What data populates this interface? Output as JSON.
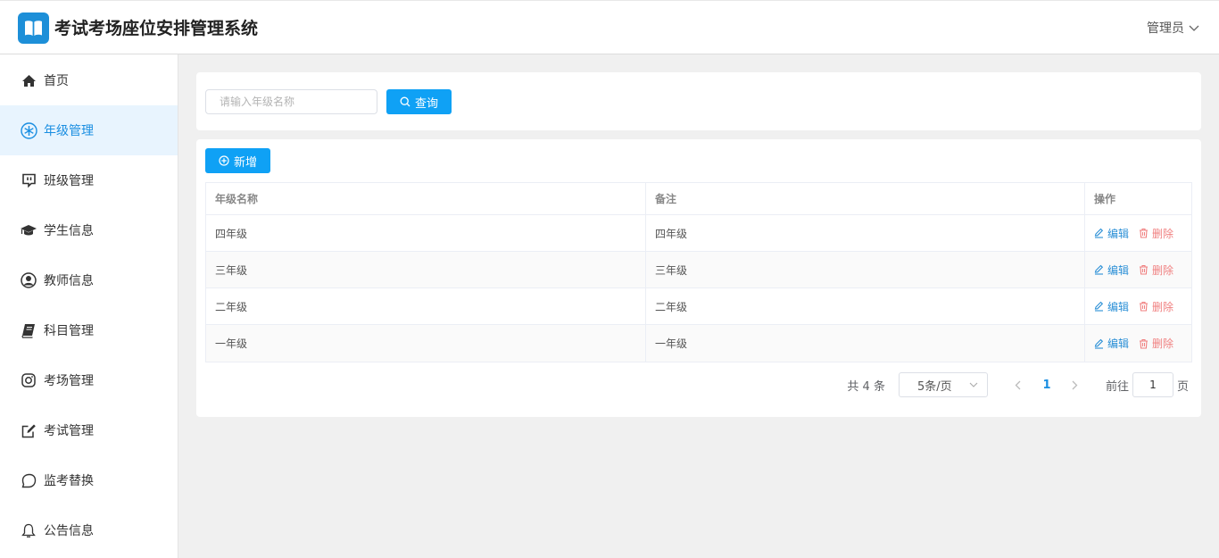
{
  "app": {
    "title": "考试考场座位安排管理系统",
    "user": "管理员"
  },
  "sidebar": {
    "items": [
      {
        "label": "首页",
        "icon": "home-icon"
      },
      {
        "label": "年级管理",
        "icon": "snowflake-icon",
        "active": true
      },
      {
        "label": "班级管理",
        "icon": "chat-box-icon"
      },
      {
        "label": "学生信息",
        "icon": "graduation-cap-icon"
      },
      {
        "label": "教师信息",
        "icon": "user-circle-icon"
      },
      {
        "label": "科目管理",
        "icon": "book-icon"
      },
      {
        "label": "考场管理",
        "icon": "camera-icon"
      },
      {
        "label": "考试管理",
        "icon": "edit-icon"
      },
      {
        "label": "监考替换",
        "icon": "speech-bubble-icon"
      },
      {
        "label": "公告信息",
        "icon": "bell-icon"
      }
    ]
  },
  "search": {
    "placeholder": "请输入年级名称",
    "value": "",
    "button": "查询"
  },
  "toolbar": {
    "add_label": "新增"
  },
  "table": {
    "columns": [
      "年级名称",
      "备注",
      "操作"
    ],
    "rows": [
      {
        "name": "四年级",
        "remark": "四年级"
      },
      {
        "name": "三年级",
        "remark": "三年级"
      },
      {
        "name": "二年级",
        "remark": "二年级"
      },
      {
        "name": "一年级",
        "remark": "一年级"
      }
    ],
    "edit_label": "编辑",
    "delete_label": "删除"
  },
  "pagination": {
    "total_text": "共 4 条",
    "page_size": "5条/页",
    "current_page": "1",
    "jump_label": "前往",
    "jump_value": "1",
    "page_suffix": "页"
  },
  "colors": {
    "primary": "#0fa1f5",
    "active_bg": "#e8f4fe",
    "link": "#2a8fd6",
    "danger": "#f08080",
    "logo": "#1d8fd8"
  }
}
